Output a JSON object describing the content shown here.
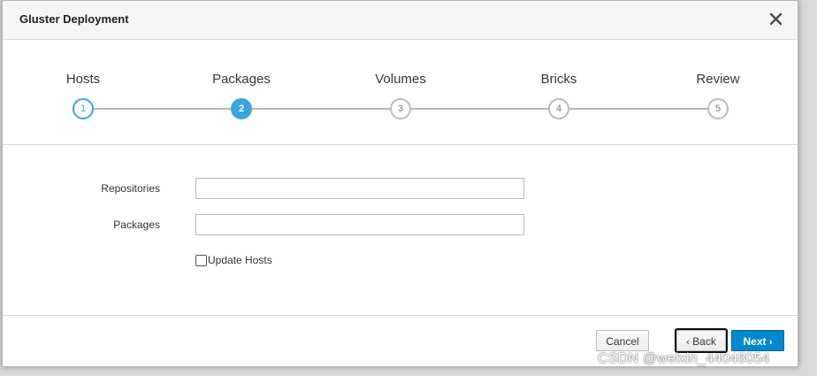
{
  "dialog": {
    "title": "Gluster Deployment",
    "close_label": "×"
  },
  "wizard": {
    "steps": [
      {
        "label": "Hosts",
        "number": "1",
        "state": "done"
      },
      {
        "label": "Packages",
        "number": "2",
        "state": "active"
      },
      {
        "label": "Volumes",
        "number": "3",
        "state": "pending"
      },
      {
        "label": "Bricks",
        "number": "4",
        "state": "pending"
      },
      {
        "label": "Review",
        "number": "5",
        "state": "pending"
      }
    ]
  },
  "form": {
    "repositories_label": "Repositories",
    "repositories_value": "",
    "packages_label": "Packages",
    "packages_value": "",
    "update_hosts_label": "Update Hosts",
    "update_hosts_checked": false
  },
  "footer": {
    "cancel_label": "Cancel",
    "back_label": "Back",
    "next_label": "Next"
  },
  "watermark": {
    "text": "CSDN @weixin_44048054"
  },
  "colors": {
    "accent": "#39a5dc",
    "primary_button": "#0088ce"
  }
}
